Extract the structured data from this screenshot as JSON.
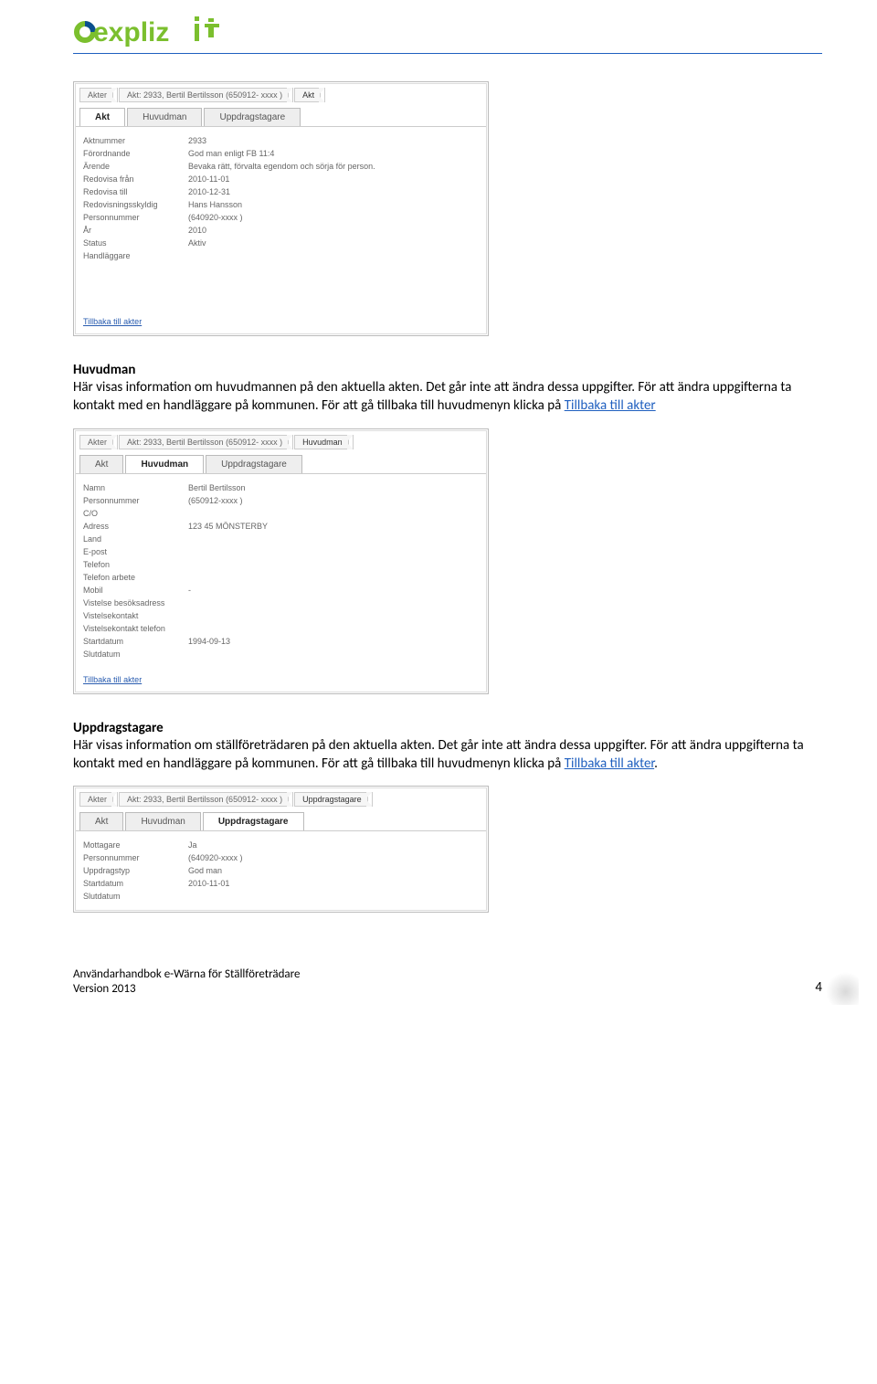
{
  "logo_text": "explizit",
  "panels": {
    "akt": {
      "breadcrumb": [
        "Akter",
        "Akt: 2933, Bertil Bertilsson (650912- xxxx )",
        "Akt"
      ],
      "tabs": [
        "Akt",
        "Huvudman",
        "Uppdragstagare"
      ],
      "active_tab": 0,
      "rows": [
        {
          "label": "Aktnummer",
          "value": "2933"
        },
        {
          "label": "Förordnande",
          "value": "God man enligt FB 11:4"
        },
        {
          "label": "Ärende",
          "value": "Bevaka rätt, förvalta egendom och sörja för person."
        },
        {
          "label": "Redovisa från",
          "value": "2010-11-01"
        },
        {
          "label": "Redovisa till",
          "value": "2010-12-31"
        },
        {
          "label": "Redovisningsskyldig",
          "value": "Hans Hansson"
        },
        {
          "label": "Personnummer",
          "value": "(640920-xxxx )"
        },
        {
          "label": "År",
          "value": "2010"
        },
        {
          "label": "Status",
          "value": "Aktiv"
        },
        {
          "label": "Handläggare",
          "value": ""
        }
      ],
      "back_link": "Tillbaka till akter"
    },
    "huvudman": {
      "breadcrumb": [
        "Akter",
        "Akt: 2933,  Bertil Bertilsson (650912- xxxx )",
        "Huvudman"
      ],
      "tabs": [
        "Akt",
        "Huvudman",
        "Uppdragstagare"
      ],
      "active_tab": 1,
      "rows": [
        {
          "label": "Namn",
          "value": "Bertil Bertilsson"
        },
        {
          "label": "Personnummer",
          "value": "(650912-xxxx )"
        },
        {
          "label": "C/O",
          "value": ""
        },
        {
          "label": "Adress",
          "value": "123 45 MÖNSTERBY"
        },
        {
          "label": "Land",
          "value": ""
        },
        {
          "label": "E-post",
          "value": ""
        },
        {
          "label": "Telefon",
          "value": ""
        },
        {
          "label": "Telefon arbete",
          "value": ""
        },
        {
          "label": "Mobil",
          "value": "-"
        },
        {
          "label": "Vistelse besöksadress",
          "value": ""
        },
        {
          "label": "Vistelsekontakt",
          "value": ""
        },
        {
          "label": "Vistelsekontakt telefon",
          "value": ""
        },
        {
          "label": "Startdatum",
          "value": "1994-09-13"
        },
        {
          "label": "Slutdatum",
          "value": ""
        }
      ],
      "back_link": "Tillbaka till akter"
    },
    "uppdragstagare": {
      "breadcrumb": [
        "Akter",
        "Akt: 2933,  Bertil Bertilsson (650912- xxxx )",
        "Uppdragstagare"
      ],
      "tabs": [
        "Akt",
        "Huvudman",
        "Uppdragstagare"
      ],
      "active_tab": 2,
      "rows": [
        {
          "label": "Mottagare",
          "value": "Ja"
        },
        {
          "label": "Personnummer",
          "value": "(640920-xxxx )"
        },
        {
          "label": "Uppdragstyp",
          "value": "God man"
        },
        {
          "label": "Startdatum",
          "value": "2010-11-01"
        },
        {
          "label": "Slutdatum",
          "value": ""
        }
      ]
    }
  },
  "sections": {
    "huvudman": {
      "heading": "Huvudman",
      "body_pre": "Här visas information om huvudmannen på den aktuella akten. Det går inte att ändra dessa uppgifter. För att ändra uppgifterna ta kontakt med en handläggare på kommunen. För att gå tillbaka till huvudmenyn klicka på ",
      "link": "Tillbaka till akter"
    },
    "uppdragstagare": {
      "heading": "Uppdragstagare",
      "body_pre": "Här visas information om ställföreträdaren på den aktuella akten. Det går inte att ändra dessa uppgifter. För att ändra uppgifterna ta kontakt med en handläggare på kommunen. För att gå tillbaka till huvudmenyn klicka på ",
      "link": "Tillbaka till akter",
      "period": "."
    }
  },
  "footer": {
    "line1": "Användarhandbok e-Wärna för Ställföreträdare",
    "line2": "Version 2013",
    "page": "4"
  }
}
